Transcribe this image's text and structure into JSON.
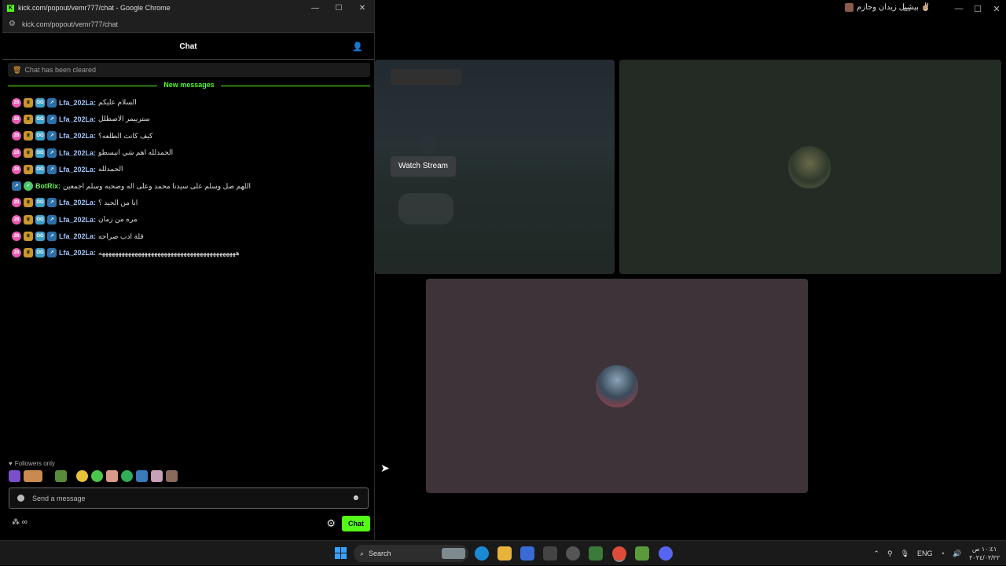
{
  "background_window": {
    "title": "بيشيل زيدان وحازم ✌🏼",
    "watch_stream_label": "Watch Stream"
  },
  "chrome": {
    "window_title": "kick.com/popout/vemr777/chat - Google Chrome",
    "url": "kick.com/popout/vemr777/chat",
    "min": "—",
    "max": "☐",
    "close": "✕"
  },
  "chat": {
    "header_title": "Chat",
    "cleared_notice": "Chat has been cleared",
    "new_messages_label": "New messages",
    "messages": [
      {
        "user": "Lfa_202La:",
        "text": "السلام عليكم"
      },
      {
        "user": "Lfa_202La:",
        "text": "سترييمر الاصطلل"
      },
      {
        "user": "Lfa_202La:",
        "text": "كيف كانت الطلعه؟"
      },
      {
        "user": "Lfa_202La:",
        "text": "الحمدلله اهم شي انبسطو"
      },
      {
        "user": "Lfa_202La:",
        "text": "الحمدلله"
      },
      {
        "user": "BotRix:",
        "text": "اللهم صل وسلم على سيدنا محمد وعلى اله وصحبه وسلم اجمعين"
      },
      {
        "user": "Lfa_202La:",
        "text": "انا من الجيد ؟"
      },
      {
        "user": "Lfa_202La:",
        "text": "مره من زمان"
      },
      {
        "user": "Lfa_202La:",
        "text": "قلة ادب صراحه"
      },
      {
        "user": "Lfa_202La:",
        "text": "ههههههههههههههههههههههههههههههههههههههههههه"
      }
    ],
    "followers_only_label": "Followers only",
    "input_placeholder": "Send a message",
    "points_label": "∞",
    "send_button": "Chat"
  },
  "taskbar": {
    "search_label": "Search",
    "language": "ENG",
    "time": "١٠:٤١ ص",
    "date": "٢٠٢٤/٠٢/٢٢"
  },
  "colors": {
    "kick_green": "#53fc18",
    "username_blue": "#a3c8ff"
  }
}
